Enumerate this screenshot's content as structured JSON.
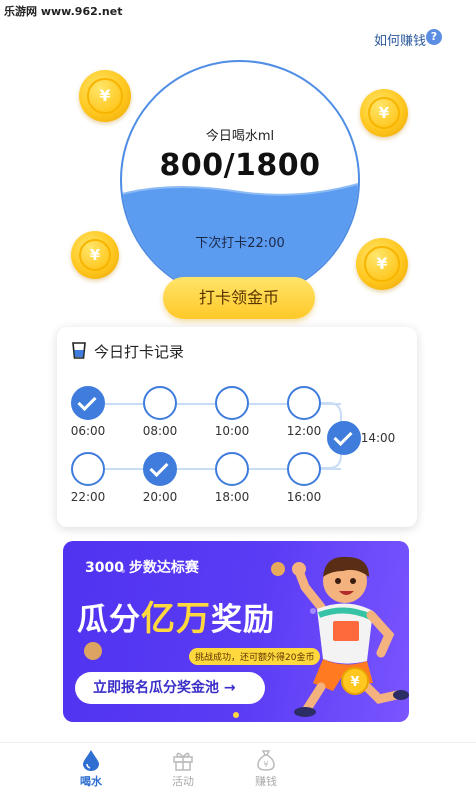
{
  "watermark": "乐游网 www.962.net",
  "help": {
    "label": "如何赚钱",
    "icon": "?"
  },
  "water": {
    "today_label": "今日喝水ml",
    "current": "800",
    "target": "1800",
    "display": "800/1800",
    "fill_fraction": 0.44,
    "next_label": "下次打卡22:00"
  },
  "coin_symbol": "¥",
  "checkin_button": "打卡领金币",
  "record": {
    "title": "今日打卡记录",
    "slots": [
      {
        "time": "06:00",
        "checked": true
      },
      {
        "time": "08:00",
        "checked": false
      },
      {
        "time": "10:00",
        "checked": false
      },
      {
        "time": "12:00",
        "checked": false
      },
      {
        "time": "14:00",
        "checked": true
      },
      {
        "time": "16:00",
        "checked": false
      },
      {
        "time": "18:00",
        "checked": false
      },
      {
        "time": "20:00",
        "checked": true
      },
      {
        "time": "22:00",
        "checked": false
      }
    ]
  },
  "banner": {
    "subtitle": "3000 步数达标赛",
    "title_a": "瓜分",
    "title_b": "亿万",
    "title_c": "奖励",
    "tag": "挑战成功，还可额外得20金币",
    "button": "立即报名瓜分奖金池 →"
  },
  "tabs": [
    {
      "label": "喝水",
      "icon": "water-drop-icon",
      "active": true
    },
    {
      "label": "活动",
      "icon": "gift-icon",
      "active": false
    },
    {
      "label": "赚钱",
      "icon": "money-bag-icon",
      "active": false
    }
  ],
  "colors": {
    "accent": "#3f7cdc",
    "water": "#5b9bf0",
    "coin": "#ffc71f",
    "button": "#ffd23a",
    "banner": "#5236f2"
  }
}
